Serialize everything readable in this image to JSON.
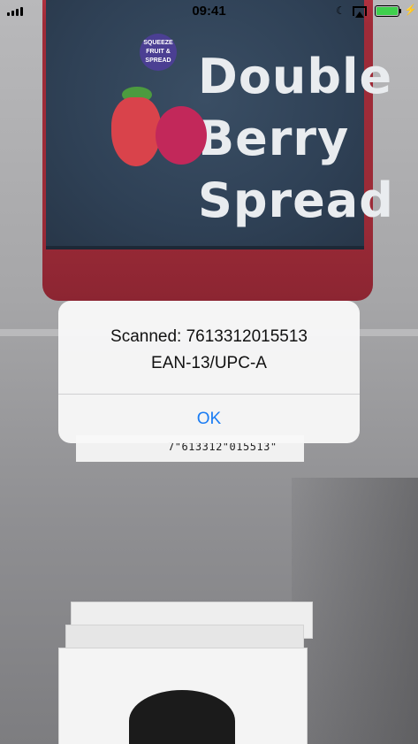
{
  "status_bar": {
    "time": "09:41",
    "signal_icon": "signal-bars-icon",
    "moon_icon": "do-not-disturb-icon",
    "airplay_icon": "screen-mirroring-icon",
    "battery_icon": "battery-charging-icon",
    "battery_color": "#3fd04d"
  },
  "camera_scene": {
    "product_brand_badge": "SQUEEZE FRUIT & SPREAD",
    "product_name_lines": [
      "Double",
      "Berry",
      "Spread"
    ],
    "barcode_digits": "7\"613312\"015513\""
  },
  "alert": {
    "title_line1": "Scanned: 7613312015513",
    "title_line2": "EAN-13/UPC-A",
    "button_ok": "OK",
    "button_color": "#1a7cf3"
  }
}
